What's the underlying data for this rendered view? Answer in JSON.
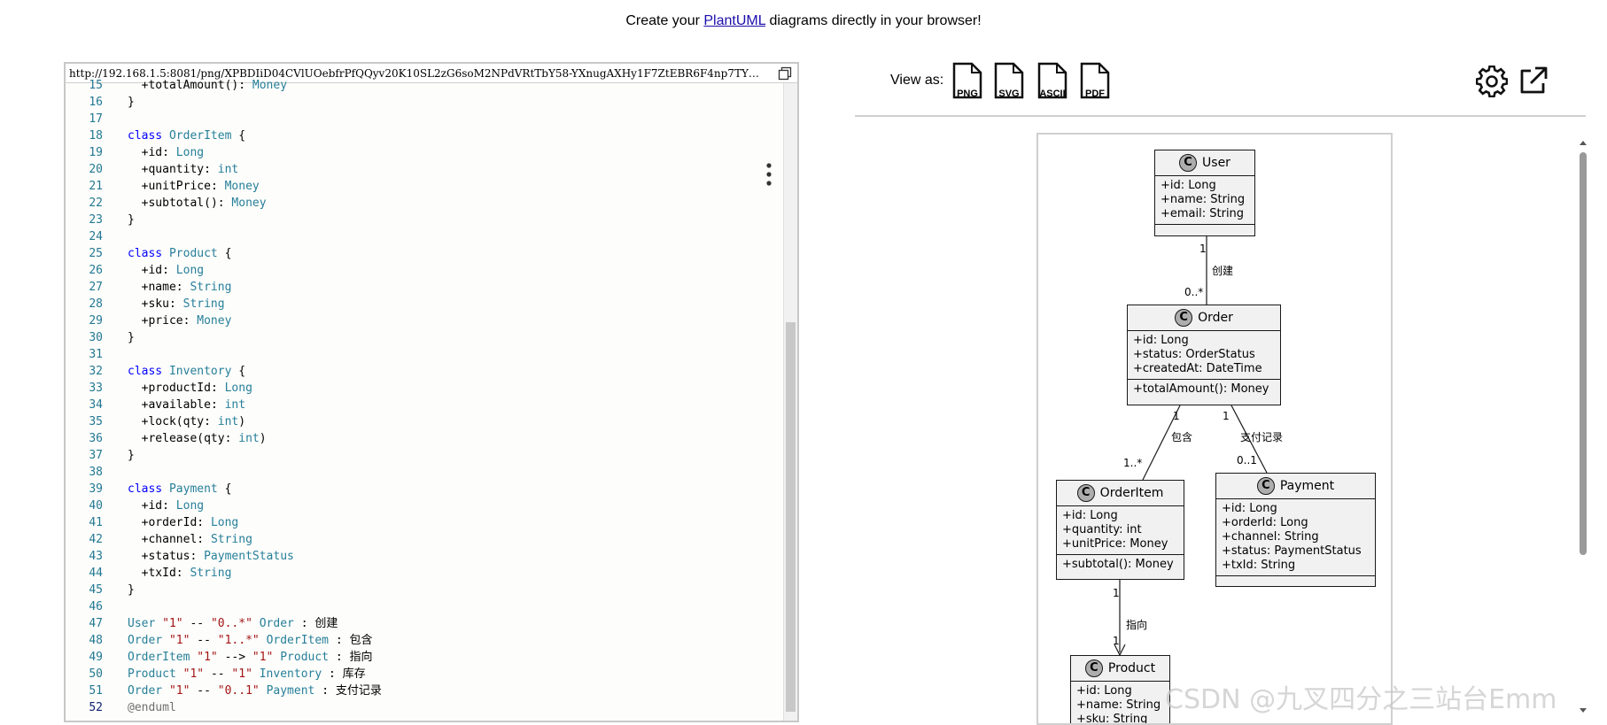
{
  "header": {
    "prefix": "Create your ",
    "link_text": "PlantUML",
    "suffix": " diagrams directly in your browser!"
  },
  "editor": {
    "url": "http://192.168.1.5:8081/png/XPBDIiD04CVlUOebfrPfQQyv20K10SL2zG6soM2NPdVRtTbY58-YXnugAXHy1F7ZtEBR6F4np7TYM_2KdV…",
    "lines": [
      {
        "n": "15",
        "t": "  +totalAmount(): Money"
      },
      {
        "n": "16",
        "t": "}"
      },
      {
        "n": "17",
        "t": ""
      },
      {
        "n": "18",
        "t": "class OrderItem {"
      },
      {
        "n": "19",
        "t": "  +id: Long"
      },
      {
        "n": "20",
        "t": "  +quantity: int"
      },
      {
        "n": "21",
        "t": "  +unitPrice: Money"
      },
      {
        "n": "22",
        "t": "  +subtotal(): Money"
      },
      {
        "n": "23",
        "t": "}"
      },
      {
        "n": "24",
        "t": ""
      },
      {
        "n": "25",
        "t": "class Product {"
      },
      {
        "n": "26",
        "t": "  +id: Long"
      },
      {
        "n": "27",
        "t": "  +name: String"
      },
      {
        "n": "28",
        "t": "  +sku: String"
      },
      {
        "n": "29",
        "t": "  +price: Money"
      },
      {
        "n": "30",
        "t": "}"
      },
      {
        "n": "31",
        "t": ""
      },
      {
        "n": "32",
        "t": "class Inventory {"
      },
      {
        "n": "33",
        "t": "  +productId: Long"
      },
      {
        "n": "34",
        "t": "  +available: int"
      },
      {
        "n": "35",
        "t": "  +lock(qty: int)"
      },
      {
        "n": "36",
        "t": "  +release(qty: int)"
      },
      {
        "n": "37",
        "t": "}"
      },
      {
        "n": "38",
        "t": ""
      },
      {
        "n": "39",
        "t": "class Payment {"
      },
      {
        "n": "40",
        "t": "  +id: Long"
      },
      {
        "n": "41",
        "t": "  +orderId: Long"
      },
      {
        "n": "42",
        "t": "  +channel: String"
      },
      {
        "n": "43",
        "t": "  +status: PaymentStatus"
      },
      {
        "n": "44",
        "t": "  +txId: String"
      },
      {
        "n": "45",
        "t": "}"
      },
      {
        "n": "46",
        "t": ""
      },
      {
        "n": "47",
        "t": "User \"1\" -- \"0..*\" Order : 创建"
      },
      {
        "n": "48",
        "t": "Order \"1\" -- \"1..*\" OrderItem : 包含"
      },
      {
        "n": "49",
        "t": "OrderItem \"1\" --> \"1\" Product : 指向"
      },
      {
        "n": "50",
        "t": "Product \"1\" -- \"1\" Inventory : 库存"
      },
      {
        "n": "51",
        "t": "Order \"1\" -- \"0..1\" Payment : 支付记录"
      },
      {
        "n": "52",
        "t": "@enduml"
      }
    ]
  },
  "view_as": {
    "label": "View as:",
    "formats": [
      "PNG",
      "SVG",
      "ASCII",
      "PDF"
    ]
  },
  "diagram": {
    "classes": {
      "user": {
        "name": "User",
        "attrs": [
          "+id: Long",
          "+name: String",
          "+email: String"
        ],
        "methods": []
      },
      "order": {
        "name": "Order",
        "attrs": [
          "+id: Long",
          "+status: OrderStatus",
          "+createdAt: DateTime"
        ],
        "methods": [
          "+totalAmount(): Money"
        ]
      },
      "orderitem": {
        "name": "OrderItem",
        "attrs": [
          "+id: Long",
          "+quantity: int",
          "+unitPrice: Money"
        ],
        "methods": [
          "+subtotal(): Money"
        ]
      },
      "payment": {
        "name": "Payment",
        "attrs": [
          "+id: Long",
          "+orderId: Long",
          "+channel: String",
          "+status: PaymentStatus",
          "+txId: String"
        ],
        "methods": []
      },
      "product": {
        "name": "Product",
        "attrs": [
          "+id: Long",
          "+name: String",
          "+sku: String"
        ],
        "methods": []
      }
    },
    "relations": [
      {
        "label": "创建",
        "from_mult": "1",
        "to_mult": "0..*"
      },
      {
        "label": "包含",
        "from_mult": "1",
        "to_mult": "1..*"
      },
      {
        "label": "支付记录",
        "from_mult": "1",
        "to_mult": "0..1"
      },
      {
        "label": "指向",
        "from_mult": "1",
        "to_mult": "1"
      }
    ]
  },
  "watermark": "CSDN @九叉四分之三站台Emm"
}
